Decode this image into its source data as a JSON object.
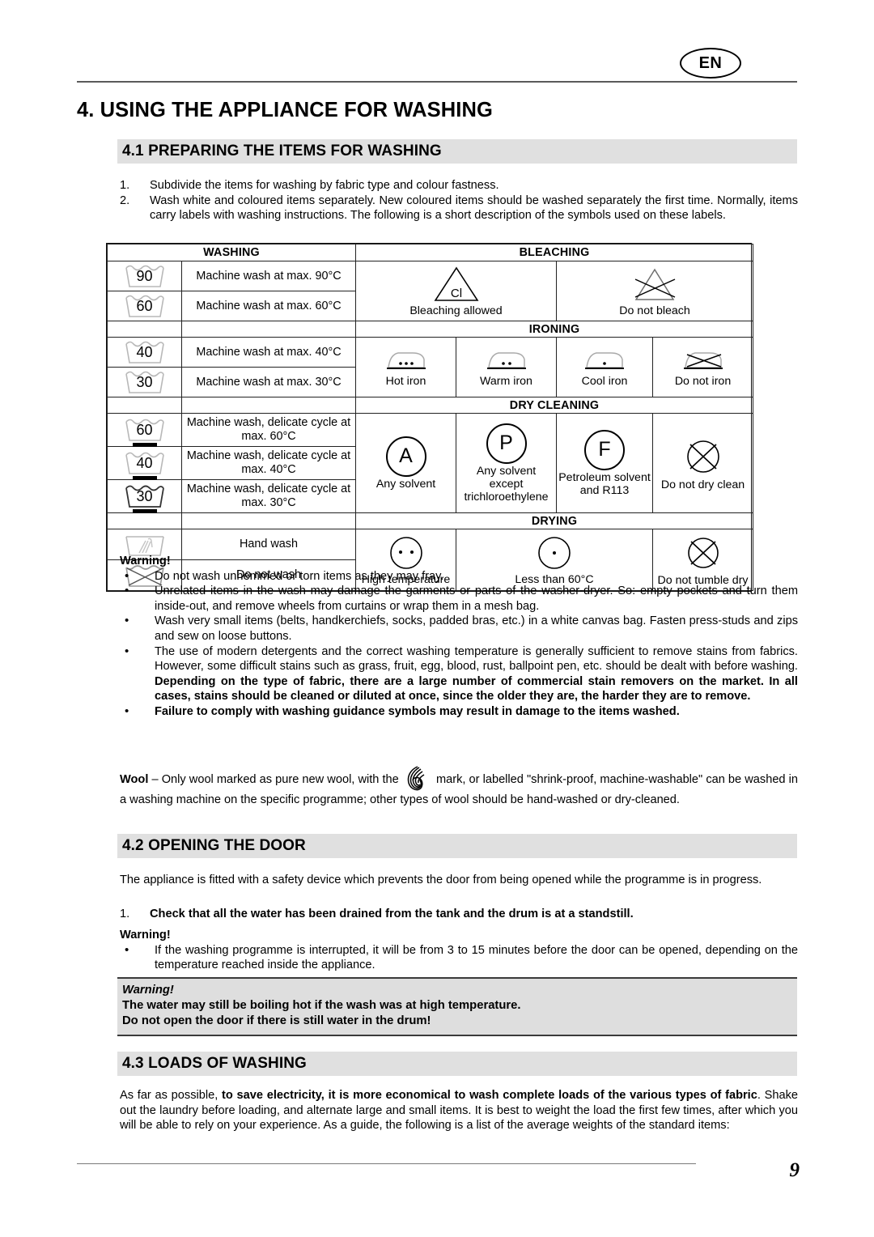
{
  "header": {
    "language_badge": "EN"
  },
  "footer": {
    "page_number": "9"
  },
  "chapter": {
    "title": "4. USING THE APPLIANCE FOR WASHING"
  },
  "section_41": {
    "heading": "4.1 PREPARING THE ITEMS FOR WASHING",
    "list": [
      {
        "num": "1.",
        "text": "Subdivide the items for washing by fabric type and colour fastness."
      },
      {
        "num": "2.",
        "text": "Wash white and coloured items separately. New coloured items should be washed separately the first time. Normally, items carry labels with washing instructions. The following is a short description of the symbols used on these labels."
      }
    ]
  },
  "symbols_table": {
    "categories": {
      "washing": "WASHING",
      "bleaching": "BLEACHING",
      "ironing": "IRONING",
      "dry_cleaning": "DRY CLEANING",
      "drying": "DRYING"
    },
    "washing_rows": [
      {
        "temp": "90",
        "delicate": false,
        "desc": "Machine wash at max. 90°C"
      },
      {
        "temp": "60",
        "delicate": false,
        "desc": "Machine wash at max. 60°C"
      },
      {
        "temp": "40",
        "delicate": false,
        "desc": "Machine wash at max. 40°C"
      },
      {
        "temp": "30",
        "delicate": false,
        "desc": "Machine wash at max. 30°C"
      },
      {
        "temp": "60",
        "delicate": true,
        "desc": "Machine wash, delicate cycle at max. 60°C"
      },
      {
        "temp": "40",
        "delicate": true,
        "desc": "Machine wash, delicate cycle at max. 40°C"
      },
      {
        "temp": "30",
        "delicate": true,
        "desc": "Machine wash, delicate cycle at max. 30°C"
      },
      {
        "temp": "",
        "delicate": false,
        "desc": "Hand wash"
      },
      {
        "temp": "",
        "delicate": false,
        "desc": "Do not wash"
      }
    ],
    "bleaching": [
      {
        "symbol_letter": "Cl",
        "label": "Bleaching allowed"
      },
      {
        "symbol_letter": "",
        "label": "Do not bleach"
      }
    ],
    "ironing": [
      {
        "dots": 3,
        "label": "Hot iron"
      },
      {
        "dots": 2,
        "label": "Warm iron"
      },
      {
        "dots": 1,
        "label": "Cool iron"
      },
      {
        "dots": 0,
        "label": "Do not iron"
      }
    ],
    "dry_cleaning": [
      {
        "letter": "A",
        "label": "Any solvent"
      },
      {
        "letter": "P",
        "label": "Any solvent except trichloroethylene"
      },
      {
        "letter": "F",
        "label": "Petroleum solvent and R113"
      },
      {
        "letter": "",
        "label": "Do not dry clean"
      }
    ],
    "drying": [
      {
        "dots": 2,
        "label": "High temperature"
      },
      {
        "dots": 1,
        "label": "Less than 60°C"
      },
      {
        "dots": 0,
        "label": "Do not tumble dry"
      }
    ]
  },
  "warning_41": {
    "title": "Warning!",
    "bullets": [
      "Do not wash unhemmed or torn items as they may fray.",
      "Unrelated items in the wash may damage the garments or parts of the washer-dryer. So: empty pockets and turn them inside-out, and remove wheels from curtains or wrap them in a mesh bag.",
      "Wash very small items (belts, handkerchiefs, socks, padded bras, etc.) in a white canvas bag. Fasten press-studs and zips and sew on loose buttons."
    ],
    "bullet4_normal": "The use of modern detergents and the correct washing temperature is generally sufficient to remove stains from fabrics. However, some difficult stains such as grass, fruit, egg, blood, rust, ballpoint pen, etc. should be dealt with before washing. ",
    "bullet4_bold": "Depending on the type of fabric, there are a large number of commercial stain removers on the market.  In all cases, stains should be cleaned or diluted at once, since the older they are, the harder they are to remove.",
    "bullet5_bold": "Failure to comply with washing guidance symbols may result in damage to the items washed."
  },
  "wool": {
    "label": "Wool",
    "text_before": " – Only wool marked as pure new wool, with the ",
    "text_after": " mark, or labelled \"shrink-proof, machine-washable\" can be washed in a washing machine on the specific programme; other types of wool should be hand-washed or dry-cleaned."
  },
  "section_42": {
    "heading": "4.2 OPENING THE DOOR",
    "intro": "The appliance is fitted with a safety device which prevents the door from being opened while the programme is in progress.",
    "step_num": "1.",
    "step_text": "Check that all the water has been drained from the tank and the drum is at a standstill.",
    "warning_title": "Warning!",
    "warning_bullet": "If the washing programme is interrupted, it will be from 3 to 15 minutes before the door can be opened, depending on the temperature reached inside the appliance.",
    "box": {
      "title": "Warning!",
      "line1": "The water may still be boiling hot if the wash was at high temperature.",
      "line2": "Do not open the door if there is still water in the drum!"
    }
  },
  "section_43": {
    "heading": "4.3 LOADS OF WASHING",
    "para_part1": "As far as possible, ",
    "para_bold1": "to save electricity, it is more economical to wash complete loads of the various types of fabric",
    "para_part2": ". Shake out the laundry before loading, and alternate large and small items. It is best to weight the load the first few times, after which you will be able to rely on your experience. As a guide, the following is a list of the average weights of the standard items:"
  }
}
